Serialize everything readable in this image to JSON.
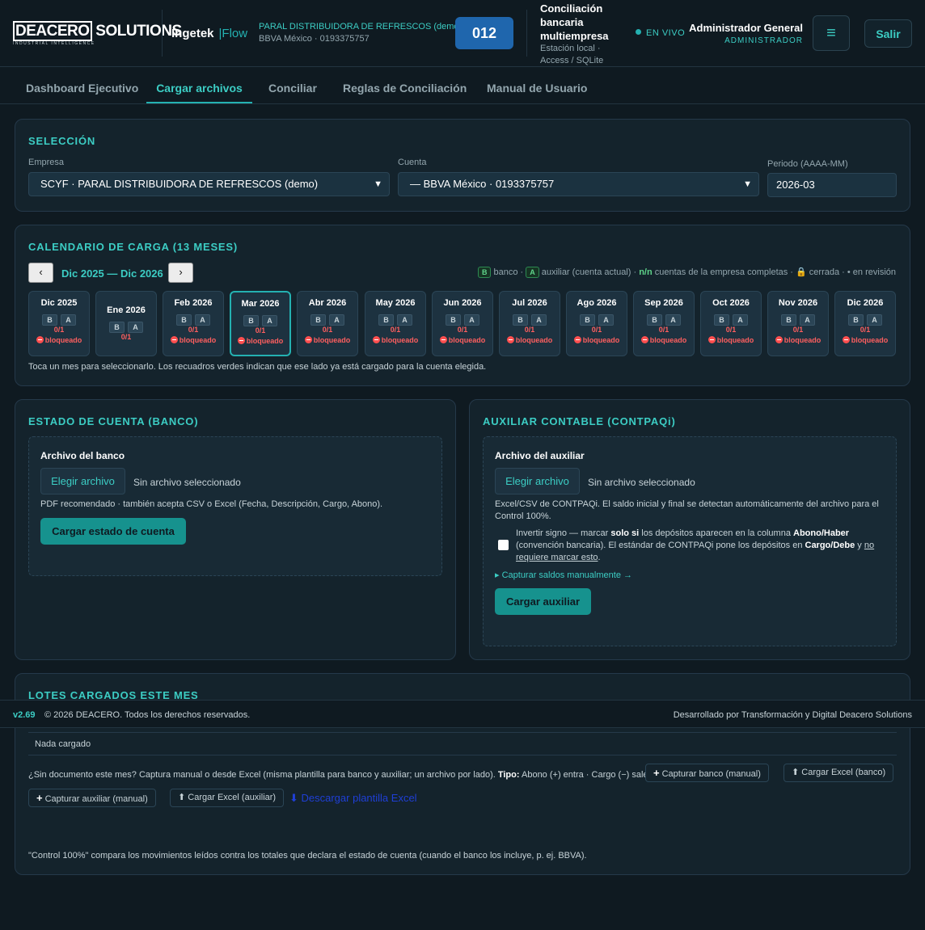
{
  "header": {
    "logo": {
      "main_a": "DEACERO",
      "main_b": "SOLUTIONS",
      "sub": "INDUSTRIAL INTELLIGENCE"
    },
    "brand": "Ingetek",
    "flow": "|Flow",
    "company_name": "PARAL DISTRIBUIDORA DE REFRESCOS (demo)",
    "company_account": "BBVA México · 0193375757",
    "code": "012",
    "system_title": "Conciliación bancaria multiempresa",
    "system_sub": "Estación local · Access / SQLite",
    "live": "EN VIVO",
    "user_name": "Administrador General",
    "user_role": "ADMINISTRADOR",
    "menu_icon": "≡",
    "logout": "Salir"
  },
  "tabs": [
    "Dashboard Ejecutivo",
    "Cargar archivos",
    "Conciliar",
    "Reglas de Conciliación",
    "Manual de Usuario"
  ],
  "selection": {
    "title": "SELECCIÓN",
    "empresa_label": "Empresa",
    "empresa_value": "SCYF · PARAL DISTRIBUIDORA DE REFRESCOS (demo)",
    "cuenta_label": "Cuenta",
    "cuenta_value": "— BBVA México · 0193375757",
    "periodo_label": "Periodo (AAAA-MM)",
    "periodo_value": "2026-03"
  },
  "calendar": {
    "title": "CALENDARIO DE CARGA (13 MESES)",
    "prev": "‹",
    "next": "›",
    "range": "Dic 2025 — Dic 2026",
    "legend": {
      "b": "B",
      "banco": "banco ·",
      "a": "A",
      "auxiliar": "auxiliar (cuenta actual) ·",
      "nn": "n/n",
      "completas": "cuentas de la empresa completas ·",
      "lock": "🔒",
      "cerrada": "cerrada ·",
      "revision": "• en revisión"
    },
    "b_letter": "B",
    "a_letter": "A",
    "blocked": "bloqueado",
    "months": [
      {
        "label": "Dic 2025",
        "count": "0/1",
        "blocked": true
      },
      {
        "label": "Ene 2026",
        "count": "0/1",
        "blocked": false
      },
      {
        "label": "Feb 2026",
        "count": "0/1",
        "blocked": true
      },
      {
        "label": "Mar 2026",
        "count": "0/1",
        "blocked": true
      },
      {
        "label": "Abr 2026",
        "count": "0/1",
        "blocked": true
      },
      {
        "label": "May 2026",
        "count": "0/1",
        "blocked": true
      },
      {
        "label": "Jun 2026",
        "count": "0/1",
        "blocked": true
      },
      {
        "label": "Jul 2026",
        "count": "0/1",
        "blocked": true
      },
      {
        "label": "Ago 2026",
        "count": "0/1",
        "blocked": true
      },
      {
        "label": "Sep 2026",
        "count": "0/1",
        "blocked": true
      },
      {
        "label": "Oct 2026",
        "count": "0/1",
        "blocked": true
      },
      {
        "label": "Nov 2026",
        "count": "0/1",
        "blocked": true
      },
      {
        "label": "Dic 2026",
        "count": "0/1",
        "blocked": true
      }
    ],
    "selected_month": "Mar 2026",
    "hint": "Toca un mes para seleccionarlo. Los recuadros verdes indican que ese lado ya está cargado para la cuenta elegida."
  },
  "bank": {
    "title": "ESTADO DE CUENTA (BANCO)",
    "file_title": "Archivo del banco",
    "choose": "Elegir archivo",
    "none": "Sin archivo seleccionado",
    "note": "PDF recomendado · también acepta CSV o Excel (Fecha, Descripción, Cargo, Abono).",
    "upload": "Cargar estado de cuenta"
  },
  "aux": {
    "title": "AUXILIAR CONTABLE (CONTPAQi)",
    "file_title": "Archivo del auxiliar",
    "choose": "Elegir archivo",
    "none": "Sin archivo seleccionado",
    "note": "Excel/CSV de CONTPAQi. El saldo inicial y final se detectan automáticamente del archivo para el Control 100%.",
    "invert_a": "Invertir signo — marcar ",
    "invert_b": "solo si",
    "invert_c": " los depósitos aparecen en la columna ",
    "invert_d": "Abono/Haber",
    "invert_e": " (convención bancaria). El estándar de CONTPAQi pone los depósitos en ",
    "invert_f": "Cargo/Debe",
    "invert_g": " y ",
    "invert_h": "no requiere marcar esto",
    "invert_i": ".",
    "manual": "▸ Capturar saldos manualmente →",
    "upload": "Cargar auxiliar"
  },
  "lots": {
    "title": "LOTES CARGADOS ESTE MES",
    "empty": "Nada cargado",
    "manual_a": "¿Sin documento este mes? Captura manual o desde Excel (misma plantilla para banco y auxiliar; un archivo por lado). ",
    "manual_tipo": "Tipo:",
    "manual_b": " Abono (+) entra · Cargo (−) sale.",
    "btn_bank_manual": "Capturar banco (manual)",
    "btn_bank_excel": "⬆ Cargar Excel (banco)",
    "btn_aux_manual": "Capturar auxiliar (manual)",
    "btn_aux_excel": "⬆ Cargar Excel (auxiliar)",
    "download": "⬇ Descargar plantilla Excel",
    "control_note": "\"Control 100%\" compara los movimientos leídos contra los totales que declara el estado de cuenta (cuando el banco los incluye, p. ej. BBVA)."
  },
  "footer": {
    "version": "v2.69",
    "copyright": "© 2026 DEACERO. Todos los derechos reservados.",
    "developed": "Desarrollado por Transformación y Digital Deacero Solutions"
  },
  "colors": {
    "accent": "#24b1b1",
    "background": "#0f1a21",
    "card": "#14232c",
    "code_badge": "#1f66ad",
    "blocked": "#ff5f5f"
  }
}
